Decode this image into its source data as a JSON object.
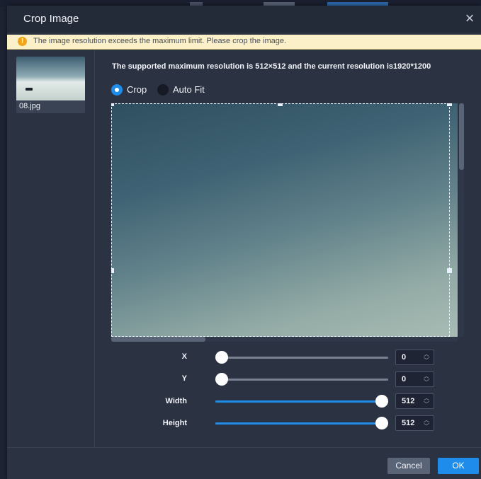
{
  "dialog": {
    "title": "Crop Image",
    "close_glyph": "×",
    "close_icon": "close-icon"
  },
  "warning": {
    "icon": "warning-icon",
    "icon_glyph": "!",
    "text": "The image resolution exceeds the maximum limit. Please crop the image.",
    "background": "#fbf0c7"
  },
  "thumbnail": {
    "filename": "08.jpg"
  },
  "resolution_text": "The supported maximum resolution is 512×512 and the current resolution is1920*1200",
  "mode": {
    "options": [
      {
        "label": "Crop",
        "selected": true
      },
      {
        "label": "Auto Fit",
        "selected": false
      }
    ]
  },
  "sliders": [
    {
      "label": "X",
      "value": "0",
      "fraction": 0.0
    },
    {
      "label": "Y",
      "value": "0",
      "fraction": 0.0
    },
    {
      "label": "Width",
      "value": "512",
      "fraction": 1.0
    },
    {
      "label": "Height",
      "value": "512",
      "fraction": 1.0
    }
  ],
  "buttons": {
    "cancel": "Cancel",
    "ok": "OK"
  },
  "colors": {
    "accent": "#1e8ceb",
    "dialog_bg": "#2b3242",
    "titlebar_bg": "#232a38"
  }
}
